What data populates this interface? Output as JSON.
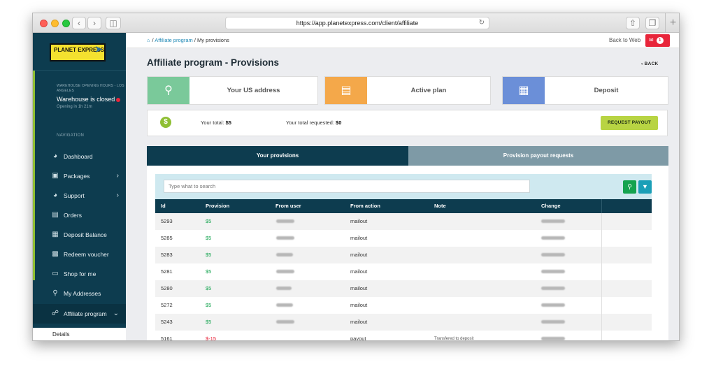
{
  "browser": {
    "url": "https://app.planetexpress.com/client/affiliate"
  },
  "sidebar": {
    "logo_text": "PLANET EXPRESS",
    "warehouse_hours_label": "WAREHOUSE OPENING HOURS - LOS ANGELES",
    "warehouse_status": "Warehouse is closed",
    "warehouse_opening": "Opening in 1h 21m",
    "nav_label": "NAVIGATION",
    "items": [
      {
        "label": "Dashboard",
        "icon": "dashboard-icon",
        "has_chevron": false
      },
      {
        "label": "Packages",
        "icon": "package-icon",
        "has_chevron": true
      },
      {
        "label": "Support",
        "icon": "support-icon",
        "has_chevron": true
      },
      {
        "label": "Orders",
        "icon": "orders-icon",
        "has_chevron": false
      },
      {
        "label": "Deposit Balance",
        "icon": "wallet-icon",
        "has_chevron": false
      },
      {
        "label": "Redeem voucher",
        "icon": "voucher-icon",
        "has_chevron": false
      },
      {
        "label": "Shop for me",
        "icon": "shopping-bag-icon",
        "has_chevron": false
      },
      {
        "label": "My Addresses",
        "icon": "location-pin-icon",
        "has_chevron": false
      },
      {
        "label": "Affiliate program",
        "icon": "affiliate-icon",
        "has_chevron": true
      }
    ],
    "sub_item": "Details"
  },
  "header": {
    "breadcrumb_link": "Affiliate program",
    "breadcrumb_current": "My provisions",
    "back_to_web": "Back to Web",
    "mail_count": "1"
  },
  "page": {
    "title": "Affiliate program - Provisions",
    "back_label": "BACK"
  },
  "cards": [
    {
      "label": "Your US address",
      "color": "#7ac99a",
      "icon": "location-pin-icon"
    },
    {
      "label": "Active plan",
      "color": "#f4a84a",
      "icon": "clipboard-icon"
    },
    {
      "label": "Deposit",
      "color": "#6b8fd8",
      "icon": "wallet-icon"
    }
  ],
  "totals": {
    "total_label": "Your total:",
    "total_value": "$5",
    "requested_label": "Your total requested:",
    "requested_value": "$0",
    "request_button": "REQUEST PAYOUT"
  },
  "tabs": {
    "active": "Your provisions",
    "inactive": "Provision payout requests"
  },
  "search": {
    "placeholder": "Type what to search"
  },
  "table": {
    "columns": [
      "Id",
      "Provision",
      "From user",
      "From action",
      "Note",
      "Change"
    ],
    "rows": [
      {
        "id": "5293",
        "provision": "$5",
        "action": "mailout",
        "note": ""
      },
      {
        "id": "5285",
        "provision": "$5",
        "action": "mailout",
        "note": ""
      },
      {
        "id": "5283",
        "provision": "$5",
        "action": "mailout",
        "note": ""
      },
      {
        "id": "5281",
        "provision": "$5",
        "action": "mailout",
        "note": ""
      },
      {
        "id": "5280",
        "provision": "$5",
        "action": "mailout",
        "note": ""
      },
      {
        "id": "5272",
        "provision": "$5",
        "action": "mailout",
        "note": ""
      },
      {
        "id": "5243",
        "provision": "$5",
        "action": "mailout",
        "note": ""
      },
      {
        "id": "5161",
        "provision": "$-15",
        "action": "payout",
        "note": "Transfered to deposit"
      }
    ]
  },
  "colors": {
    "sidebar_bg": "#0d3c4f",
    "accent_green": "#8fbf34",
    "provision_green": "#14a34f",
    "badge_red": "#e8253a"
  }
}
